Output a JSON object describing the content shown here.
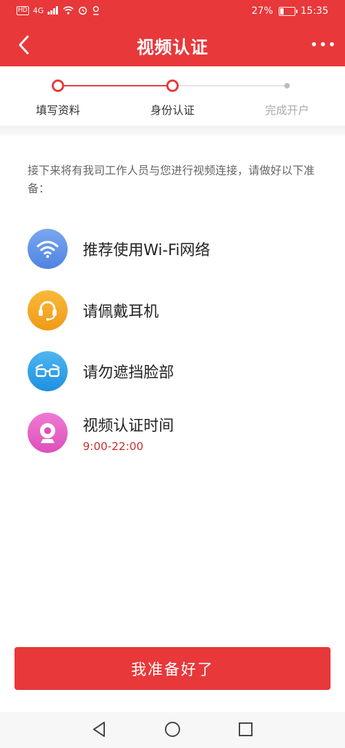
{
  "status_bar": {
    "signal_text": "4G",
    "battery": "27%",
    "battery_level": 0.27,
    "time": "15:35"
  },
  "header": {
    "title": "视频认证",
    "back_icon": "chevron-left-icon",
    "more_icon": "more-horizontal-icon"
  },
  "steps": [
    {
      "label": "填写资料",
      "state": "done"
    },
    {
      "label": "身份认证",
      "state": "current"
    },
    {
      "label": "完成开户",
      "state": "pending"
    }
  ],
  "intro": "接下来将有我司工作人员与您进行视频连接，请做好以下准备：",
  "items": [
    {
      "label": "推荐使用Wi-Fi网络",
      "icon": "wifi-icon",
      "color": "#5b8fe6"
    },
    {
      "label": "请佩戴耳机",
      "icon": "headset-icon",
      "color": "#f4a623"
    },
    {
      "label": "请勿遮挡脸部",
      "icon": "glasses-icon",
      "color": "#2ea0e8"
    },
    {
      "label": "视频认证时间",
      "sub": "9:00-22:00",
      "icon": "camera-icon",
      "color": "#e55fc4"
    }
  ],
  "ready_button": "我准备好了",
  "colors": {
    "accent": "#e8383a",
    "time_text": "#c8322f"
  },
  "nav": [
    "back-nav-icon",
    "home-nav-icon",
    "recents-nav-icon"
  ]
}
